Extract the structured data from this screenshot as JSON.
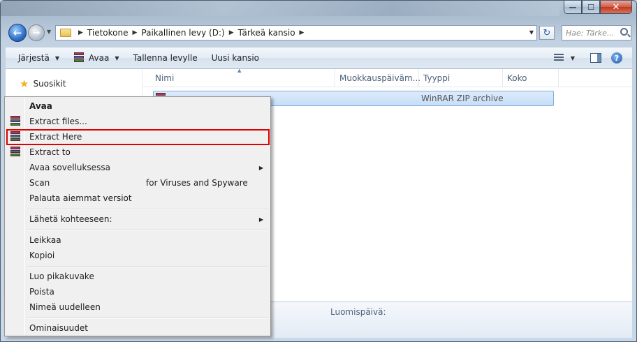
{
  "window": {
    "caption": {
      "minimize": "—",
      "maximize": "☐",
      "close": "✕"
    }
  },
  "address": {
    "crumbs": [
      "Tietokone",
      "Paikallinen levy (D:)",
      "Tärkeä kansio"
    ],
    "search_placeholder": "Hae: Tärke..."
  },
  "toolbar": {
    "organize": "Järjestä",
    "open": "Avaa",
    "burn": "Tallenna levylle",
    "new_folder": "Uusi kansio",
    "help": "?"
  },
  "nav": {
    "favorites": "Suosikit"
  },
  "columns": [
    "Nimi",
    "Muokkauspäiväm...",
    "Tyyppi",
    "Koko"
  ],
  "file": {
    "type": "WinRAR ZIP archive"
  },
  "details": {
    "created_label": "Luomispäivä:"
  },
  "context_menu": {
    "open": "Avaa",
    "extract_files": "Extract files...",
    "extract_here": "Extract Here",
    "extract_to": "Extract to",
    "open_with": "Avaa sovelluksessa",
    "scan": "Scan",
    "scan_suffix": "for Viruses and Spyware",
    "restore": "Palauta aiemmat versiot",
    "send_to": "Lähetä kohteeseen:",
    "cut": "Leikkaa",
    "copy": "Kopioi",
    "create_shortcut": "Luo pikakuvake",
    "delete": "Poista",
    "rename": "Nimeä uudelleen",
    "properties": "Ominaisuudet"
  },
  "colors": {
    "highlight_border": "#e00000",
    "selection": "#c6def8"
  }
}
